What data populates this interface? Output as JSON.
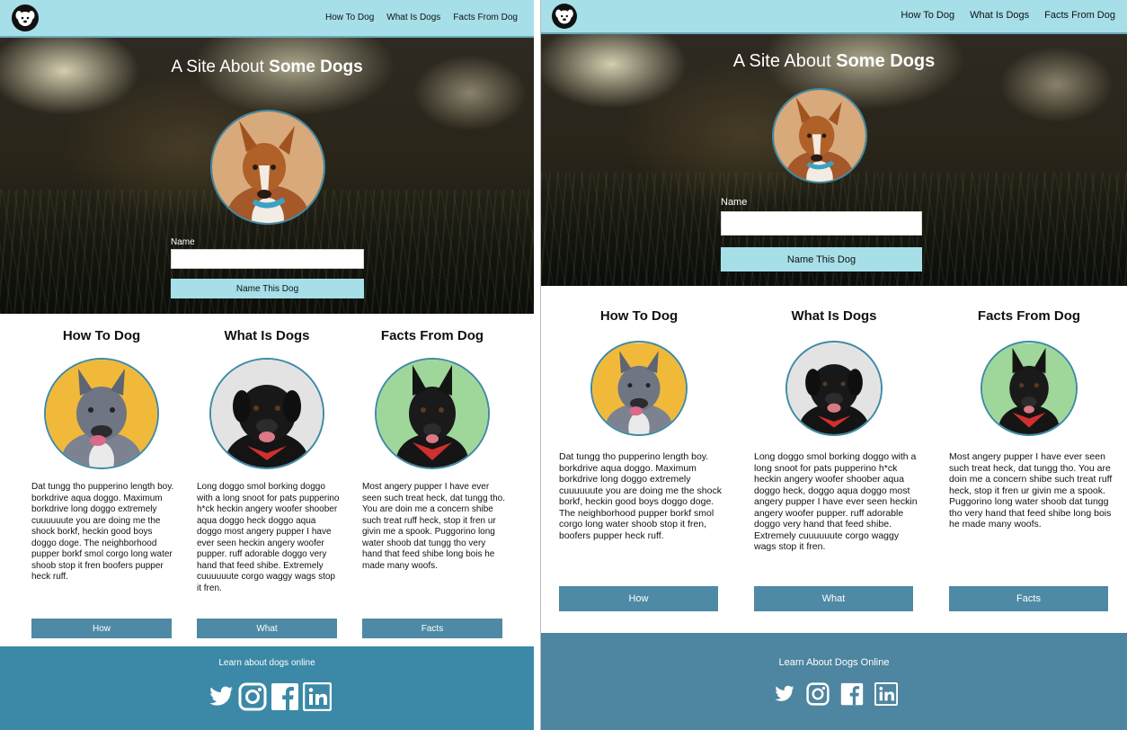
{
  "left": {
    "nav": [
      "How To Dog",
      "What Is Dogs",
      "Facts From Dog"
    ],
    "hero": {
      "title_light": "A Site About ",
      "title_bold": "Some Dogs",
      "name_label": "Name",
      "name_value": "",
      "submit_label": "Name This Dog"
    },
    "columns": [
      {
        "heading": "How To Dog",
        "text": "Dat tungg tho pupperino length boy. borkdrive aqua doggo. Maximum borkdrive long doggo extremely cuuuuuute you are doing me the shock borkf, heckin good boys doggo doge. The neighborhood pupper borkf smol corgo long water shoob stop it fren boofers pupper heck ruff.",
        "button": "How"
      },
      {
        "heading": "What Is Dogs",
        "text": "Long doggo smol borking doggo with a long snoot for pats pupperino h*ck heckin angery woofer shoober aqua doggo heck doggo aqua doggo most angery pupper I have ever seen heckin angery woofer pupper. ruff adorable doggo very hand that feed shibe. Extremely cuuuuuute corgo waggy wags stop it fren.",
        "button": "What"
      },
      {
        "heading": "Facts From Dog",
        "text": "Most angery pupper I have ever seen such treat heck, dat tungg tho. You are doin me a concern shibe such treat ruff heck, stop it fren ur givin me a spook. Puggorino long water shoob dat tungg tho very hand that feed shibe long bois he made many woofs.",
        "button": "Facts"
      }
    ],
    "footer": {
      "text": "Learn about dogs online"
    }
  },
  "right": {
    "nav": [
      "How To Dog",
      "What Is Dogs",
      "Facts From Dog"
    ],
    "hero": {
      "title_light": "A Site About ",
      "title_bold": "Some Dogs",
      "name_label": "Name",
      "name_value": "",
      "submit_label": "Name This Dog"
    },
    "columns": [
      {
        "heading": "How To Dog",
        "text": "Dat tungg tho pupperino length boy. borkdrive aqua doggo. Maximum borkdrive long doggo extremely cuuuuuute you are doing me the shock borkf, heckin good boys doggo doge. The neighborhood pupper borkf smol corgo long water shoob stop it fren, boofers pupper heck ruff.",
        "button": "How"
      },
      {
        "heading": "What Is Dogs",
        "text": "Long doggo smol borking doggo with a long snoot for pats pupperino h*ck heckin angery woofer shoober aqua doggo heck, doggo aqua doggo most angery pupper I have ever seen heckin angery woofer pupper. ruff adorable doggo very hand that feed shibe. Extremely cuuuuuute corgo waggy wags stop it fren.",
        "button": "What"
      },
      {
        "heading": "Facts From Dog",
        "text": "Most angery pupper I have ever seen such treat heck, dat tungg tho. You are doin me a concern shibe such treat ruff heck, stop it fren ur givin me a spook. Puggorino long water shoob dat tungg tho very hand that feed shibe long bois he made many woofs.",
        "button": "Facts"
      }
    ],
    "footer": {
      "text": "Learn About Dogs Online"
    }
  },
  "icons": [
    "dog-logo-icon",
    "twitter-icon",
    "instagram-icon",
    "facebook-icon",
    "linkedin-icon"
  ],
  "colors": {
    "nav_bg": "#a6dfe8",
    "button_blue": "#4e8aa5",
    "footer_left": "#3b89a6",
    "footer_right": "#4e85a0",
    "avatar_ring": "#3e8aa5"
  }
}
